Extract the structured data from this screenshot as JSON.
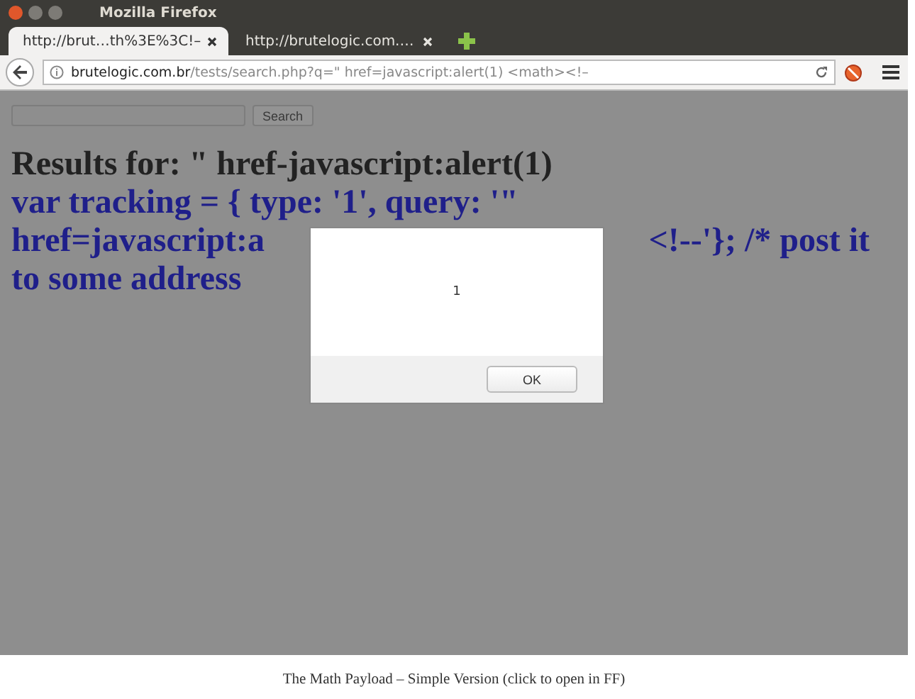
{
  "window": {
    "title": "Mozilla Firefox"
  },
  "tabs": [
    {
      "label": "http://brut…th%3E%3C!–",
      "selected": true
    },
    {
      "label": "http://brutelogic.com.…",
      "selected": false
    }
  ],
  "address": {
    "host": "brutelogic.com.br",
    "path": "/tests/search.php?q=\" href=javascript:alert(1) <math><!–"
  },
  "page": {
    "search_button": "Search",
    "heading": "Results for: \" href-javascript:alert(1)",
    "script_lines": [
      "var tracking = { type: '1', query: '\"",
      "href=javascript:a",
      "<!--'}; /* post it",
      "to some address"
    ]
  },
  "dialog": {
    "message": "1",
    "button": "OK"
  },
  "caption": "The Math Payload – Simple Version (click to open in FF)"
}
